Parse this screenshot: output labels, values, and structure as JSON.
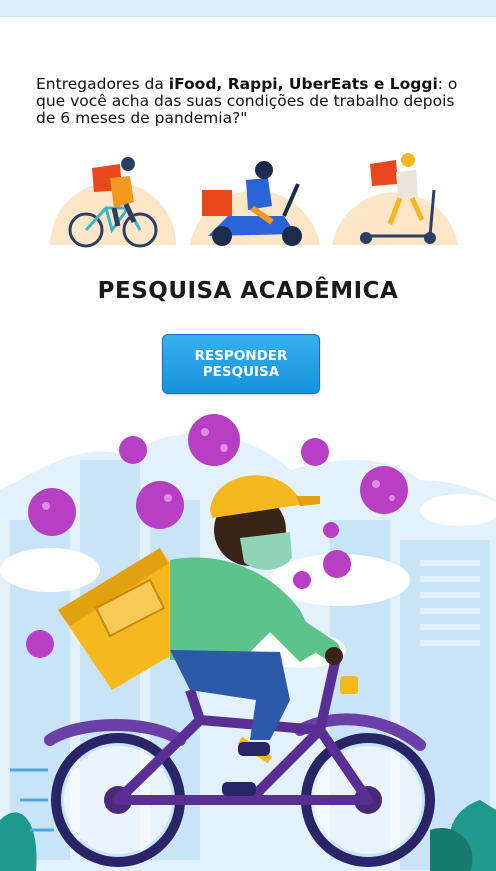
{
  "intro": {
    "prefix": "Entregadores da ",
    "brands": "iFood, Rappi, UberEats e Loggi",
    "suffix": ": o que você acha das suas condições de trabalho depois de 6 meses de pandemia?\""
  },
  "icons": [
    "bicycle-courier-icon",
    "scooter-courier-icon",
    "kick-scooter-courier-icon"
  ],
  "title": "PESQUISA ACADÊMICA",
  "cta": {
    "line1": "RESPONDER",
    "line2": "PESQUISA"
  },
  "hero_illustration": "delivery-rider-covid-illustration",
  "colors": {
    "cta": "#1a9be0",
    "virus": "#b73fc4",
    "sky": "#dcefff",
    "bike": "#4a2a7a",
    "helmet": "#f5b81f",
    "bag": "#f7b527",
    "jacket": "#5cc48a"
  }
}
